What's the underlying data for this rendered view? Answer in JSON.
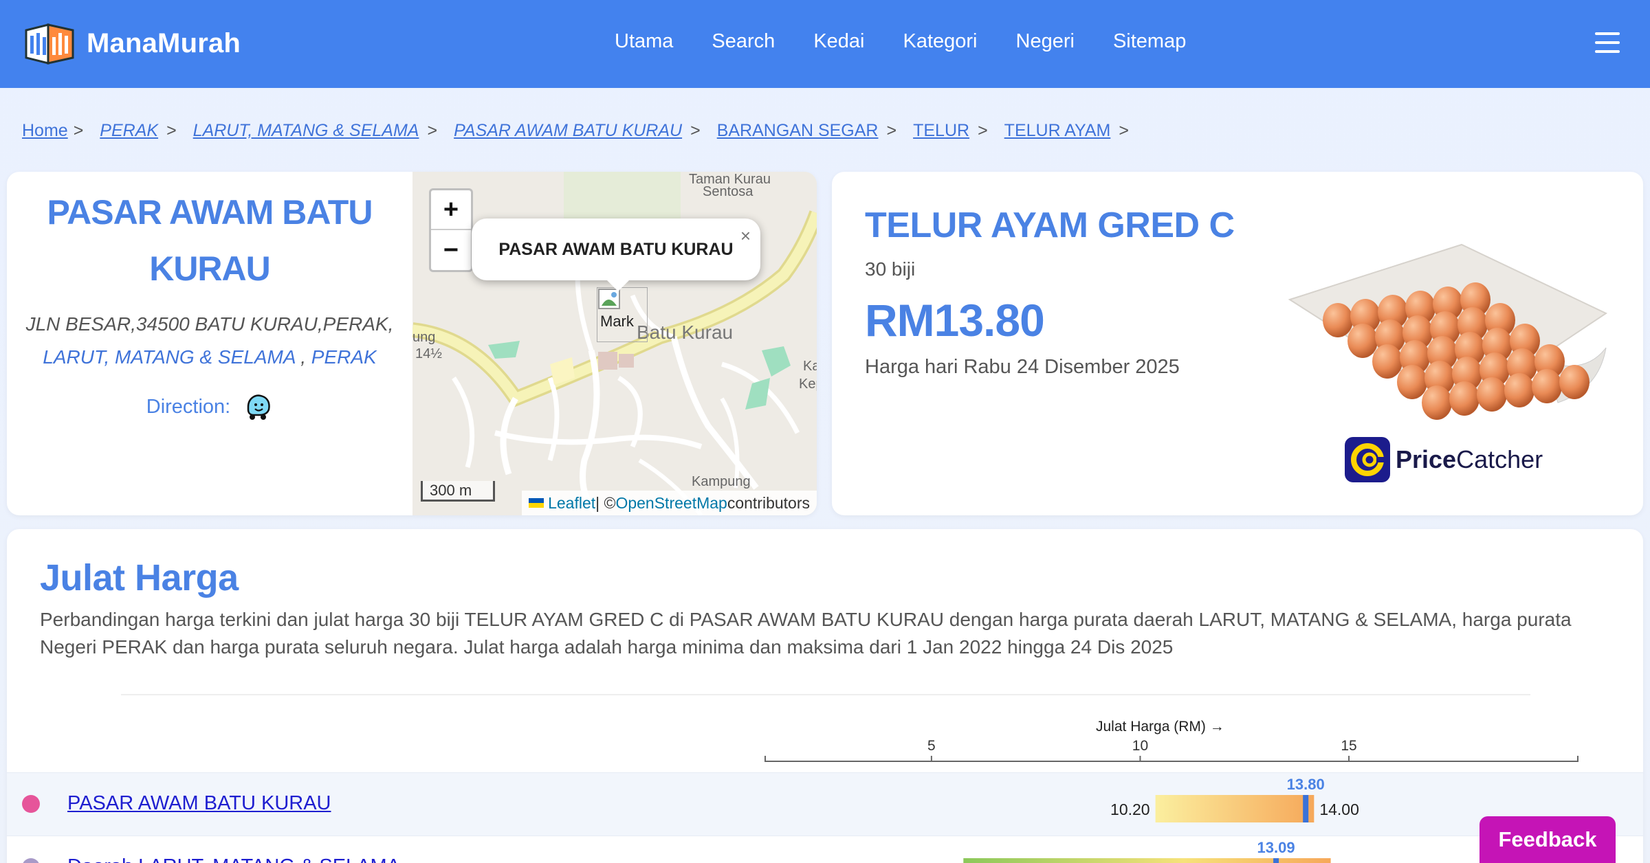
{
  "brand": {
    "name": "ManaMurah"
  },
  "nav": {
    "items": [
      "Utama",
      "Search",
      "Kedai",
      "Kategori",
      "Negeri",
      "Sitemap"
    ]
  },
  "breadcrumb": {
    "home": "Home",
    "items": [
      "PERAK",
      "LARUT, MATANG & SELAMA",
      "PASAR AWAM BATU KURAU",
      "BARANGAN SEGAR",
      "TELUR",
      "TELUR AYAM"
    ]
  },
  "store": {
    "title": "PASAR AWAM BATU KURAU",
    "address_line": "JLN BESAR,34500 BATU KURAU,PERAK,",
    "district_link": "LARUT, MATANG & SELAMA",
    "state_link": "PERAK",
    "direction_label": "Direction:"
  },
  "map": {
    "popup_text": "PASAR AWAM BATU KURAU",
    "marker_label": "Mark",
    "town_label": "Batu Kurau",
    "label_top_1": "Taman Kurau",
    "label_top_2": "Sentosa",
    "label_left_1": "ung",
    "label_left_2": "14½",
    "label_right_1": "Ka",
    "label_right_2": "Kep",
    "label_bottom": "Kampung",
    "scale": "300 m",
    "attribution_leaflet": "Leaflet",
    "attribution_sep": " | © ",
    "attribution_osm": "OpenStreetMap",
    "attribution_tail": " contributors"
  },
  "product": {
    "title": "TELUR AYAM GRED C",
    "quantity": "30 biji",
    "price": "RM13.80",
    "date": "Harga hari Rabu 24 Disember 2025",
    "source_logo_bold": "Price",
    "source_logo_regular": "Catcher"
  },
  "range": {
    "title": "Julat Harga",
    "description": "Perbandingan harga terkini dan julat harga 30 biji TELUR AYAM GRED C di PASAR AWAM BATU KURAU dengan harga purata daerah LARUT, MATANG & SELAMA, harga purata Negeri PERAK dan harga purata seluruh negara. Julat harga adalah harga minima dan maksima dari 1 Jan 2022 hingga 24 Dis 2025",
    "axis_title": "Julat Harga (RM) →"
  },
  "chart_data": {
    "type": "bar",
    "subtype": "range",
    "xlabel": "Julat Harga (RM) →",
    "x_ticks": [
      5,
      10,
      15
    ],
    "xlim": [
      1,
      20.5
    ],
    "rows": [
      {
        "name": "PASAR AWAM BATU KURAU",
        "min": 10.2,
        "max": 14.0,
        "current": 13.8,
        "min_label": "10.20",
        "max_label": "14.00",
        "current_label": "13.80",
        "dot_color": "#e6559a"
      },
      {
        "name": "Daerah LARUT, MATANG & SELAMA",
        "min": 5.6,
        "max": 14.4,
        "current": 13.09,
        "current_label": "13.09",
        "dot_color": "#a89ac8"
      }
    ]
  },
  "colors": {
    "nav": "#4382ee",
    "accent": "#4a82e4",
    "link": "#3f73d9",
    "feedback": "#c514b6"
  },
  "feedback": {
    "label": "Feedback"
  }
}
